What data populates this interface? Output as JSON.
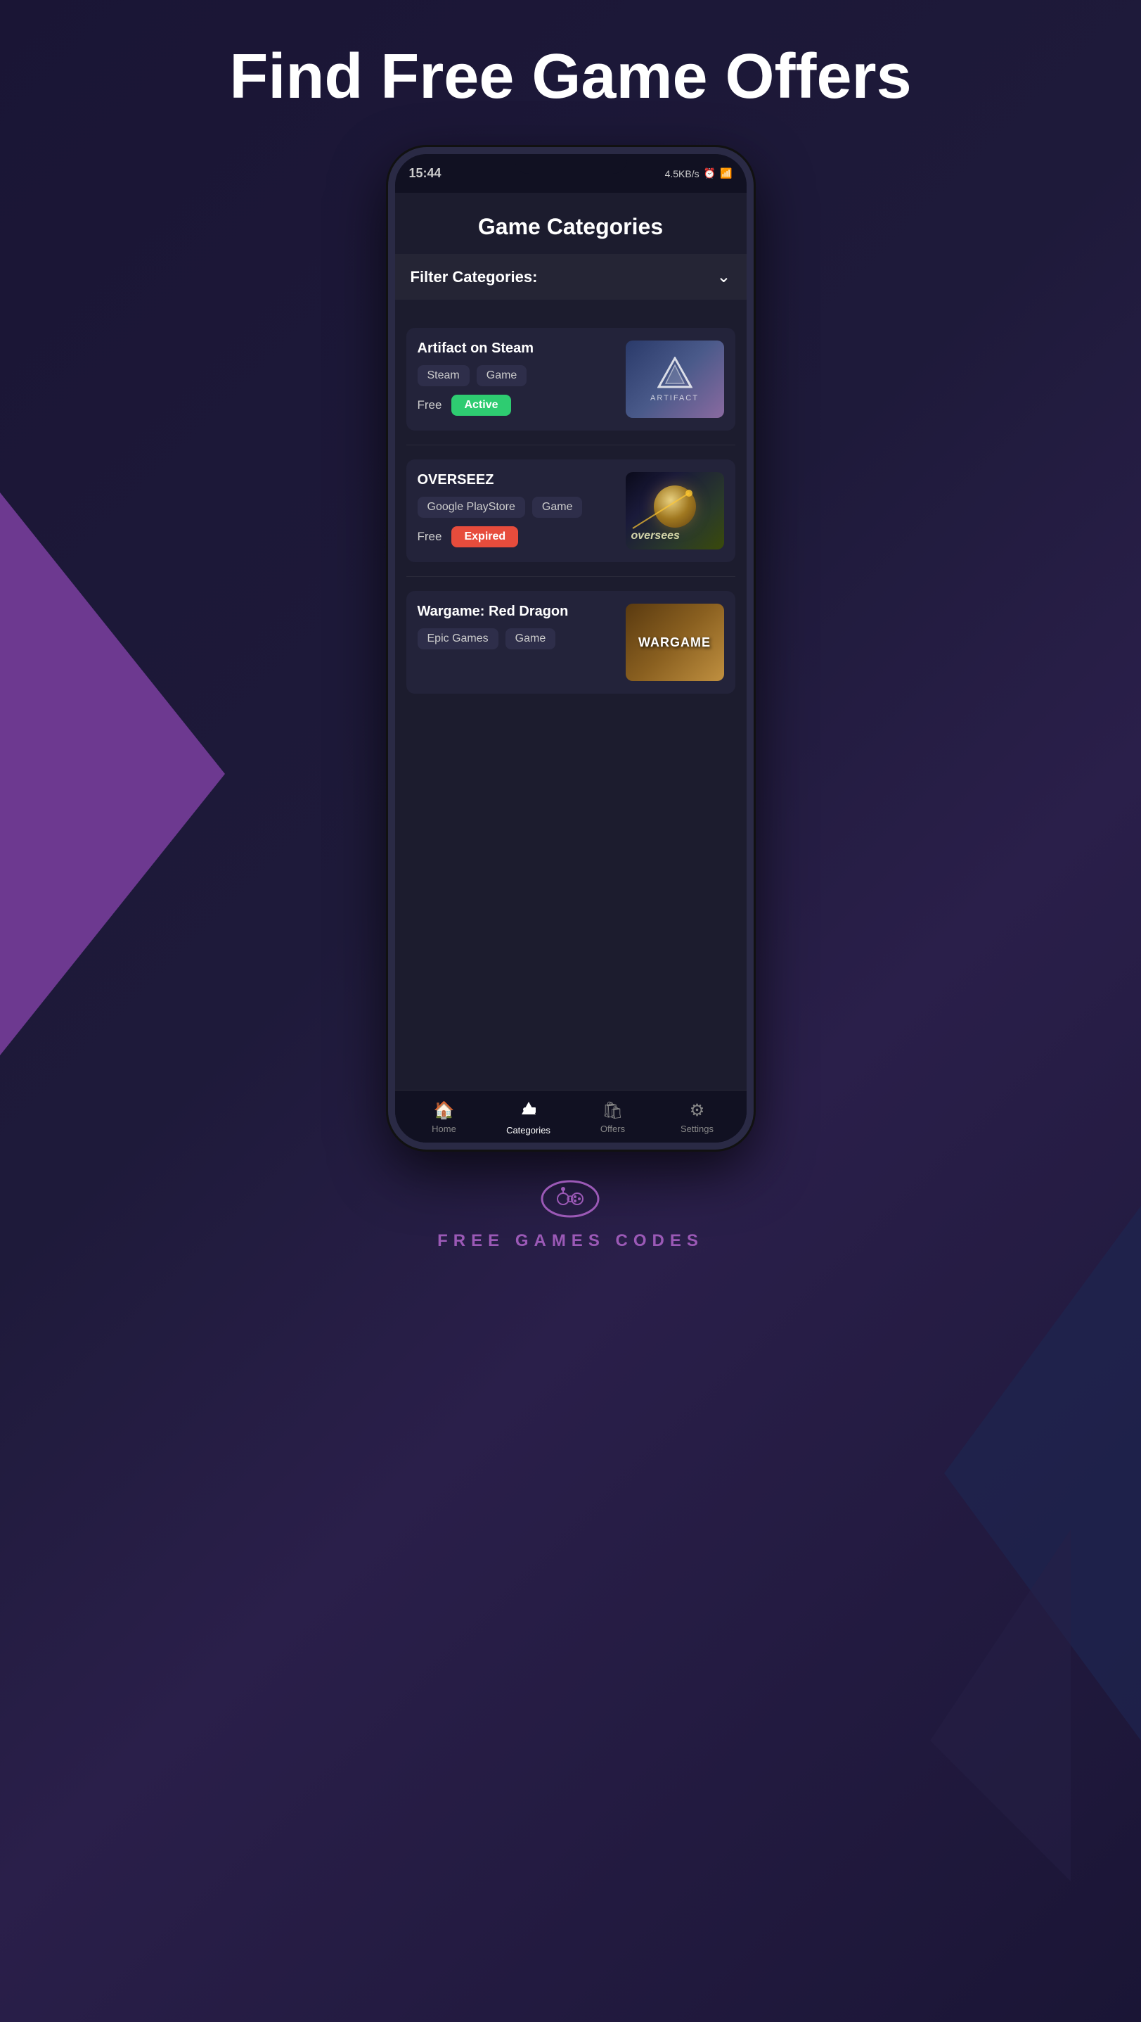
{
  "page": {
    "main_title": "Find Free Game Offers"
  },
  "phone": {
    "status_bar": {
      "time": "15:44",
      "right_info": "4.5KB/s ⏰ 📶"
    }
  },
  "app": {
    "title": "Game Categories",
    "filter_label": "Filter Categories:",
    "filter_chevron": "⌄"
  },
  "games": [
    {
      "id": "artifact",
      "title": "Artifact on Steam",
      "tags": [
        "Steam",
        "Game"
      ],
      "price": "Free",
      "status": "Active",
      "status_type": "active",
      "thumbnail_alt": "Artifact game thumbnail"
    },
    {
      "id": "overseez",
      "title": "OVERSEEZ",
      "tags": [
        "Google PlayStore",
        "Game"
      ],
      "price": "Free",
      "status": "Expired",
      "status_type": "expired",
      "thumbnail_alt": "Oversees game thumbnail"
    },
    {
      "id": "wargame",
      "title": "Wargame: Red Dragon",
      "tags": [
        "Epic Games",
        "Game"
      ],
      "price": "",
      "status": "",
      "status_type": "",
      "thumbnail_alt": "Wargame Red Dragon thumbnail"
    }
  ],
  "nav": {
    "items": [
      {
        "id": "home",
        "label": "Home",
        "icon": "🏠",
        "active": false
      },
      {
        "id": "categories",
        "label": "Categories",
        "icon": "◭",
        "active": true
      },
      {
        "id": "offers",
        "label": "Offers",
        "icon": "🛍",
        "active": false
      },
      {
        "id": "settings",
        "label": "Settings",
        "icon": "⚙",
        "active": false
      }
    ]
  },
  "footer": {
    "logo_text": "FREE GAMES CODES"
  }
}
